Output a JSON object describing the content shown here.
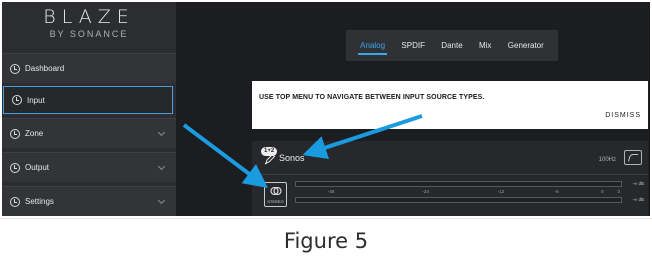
{
  "logo": {
    "main": "BLAZE",
    "sub": "BY SONANCE"
  },
  "sidebar": {
    "items": [
      {
        "label": "Dashboard",
        "icon": "clock-icon",
        "has_chevron": false,
        "active": false
      },
      {
        "label": "Input",
        "icon": "input-icon",
        "has_chevron": false,
        "active": true
      },
      {
        "label": "Zone",
        "icon": "zone-icon",
        "has_chevron": true,
        "active": false
      },
      {
        "label": "Output",
        "icon": "output-icon",
        "has_chevron": true,
        "active": false
      },
      {
        "label": "Settings",
        "icon": "gear-icon",
        "has_chevron": true,
        "active": false
      }
    ]
  },
  "top_menu": {
    "tabs": [
      "Analog",
      "SPDIF",
      "Dante",
      "Mix",
      "Generator"
    ],
    "active": "Analog"
  },
  "notice": {
    "message": "USE TOP MENU TO NAVIGATE BETWEEN INPUT SOURCE TYPES.",
    "dismiss": "DISMISS"
  },
  "input": {
    "channel_badge": "1+2",
    "name": "Sonos",
    "hpf": "100Hz",
    "stereo_label": "STEREO",
    "meter_ticks": [
      "-48",
      "-24",
      "-12",
      "-6",
      "0",
      "3"
    ],
    "meter_levels": [
      "-∞ dB",
      "-∞ dB"
    ]
  },
  "caption": "Figure 5",
  "colors": {
    "accent": "#3ba6e8",
    "arrow": "#1a9be0",
    "sidebar_bg": "#2b2d31",
    "app_bg": "#1b1d21"
  }
}
